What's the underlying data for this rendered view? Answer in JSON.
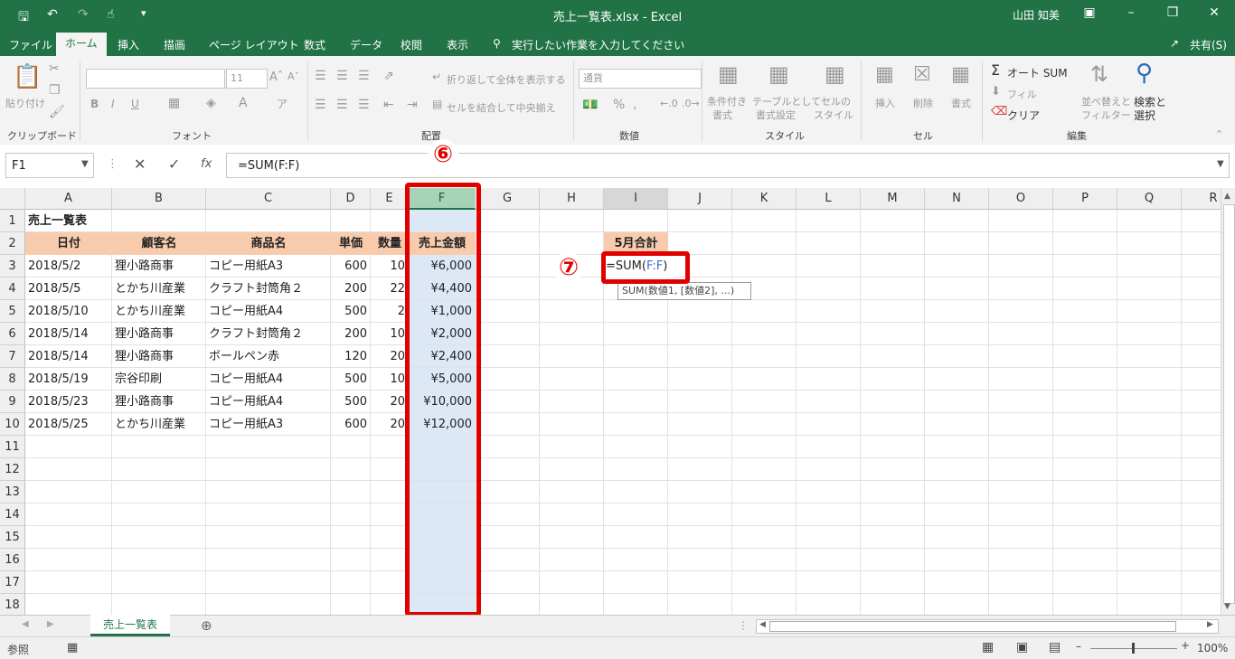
{
  "window": {
    "title": "売上一覧表.xlsx  -  Excel",
    "user": "山田 知美"
  },
  "tabs": [
    "ファイル",
    "ホーム",
    "挿入",
    "描画",
    "ページ レイアウト",
    "数式",
    "データ",
    "校閲",
    "表示"
  ],
  "active_tab": "ホーム",
  "tell_me": "実行したい作業を入力してください",
  "share": "共有(S)",
  "ribbon": {
    "clipboard": {
      "label": "クリップボード",
      "paste": "貼り付け"
    },
    "font": {
      "label": "フォント",
      "size": "11",
      "bold": "B",
      "italic": "I",
      "underline": "U"
    },
    "alignment": {
      "label": "配置",
      "wrap": "折り返して全体を表示する",
      "merge": "セルを結合して中央揃え"
    },
    "number": {
      "label": "数値",
      "format": "通貨"
    },
    "styles": {
      "label": "スタイル",
      "cond1": "条件付き",
      "cond2": "書式",
      "table1": "テーブルとして",
      "table2": "書式設定",
      "cell1": "セルの",
      "cell2": "スタイル"
    },
    "cells": {
      "label": "セル",
      "insert": "挿入",
      "delete": "削除",
      "format": "書式"
    },
    "editing": {
      "label": "編集",
      "autosum": "オート SUM",
      "fill": "フィル",
      "clear": "クリア",
      "sort1": "並べ替えと",
      "sort2": "フィルター",
      "find1": "検索と",
      "find2": "選択"
    }
  },
  "formula_bar": {
    "name_box": "F1",
    "formula": "=SUM(F:F)"
  },
  "columns": [
    "A",
    "B",
    "C",
    "D",
    "E",
    "F",
    "G",
    "H",
    "I",
    "J",
    "K",
    "L",
    "M",
    "N",
    "O",
    "P",
    "Q",
    "R"
  ],
  "rows": [
    "1",
    "2",
    "3",
    "4",
    "5",
    "6",
    "7",
    "8",
    "9",
    "10",
    "11",
    "12",
    "13",
    "14",
    "15",
    "16",
    "17",
    "18"
  ],
  "sheet": {
    "title": "売上一覧表",
    "headers": [
      "日付",
      "顧客名",
      "商品名",
      "単価",
      "数量",
      "売上金額"
    ],
    "data": [
      [
        "2018/5/2",
        "狸小路商事",
        "コピー用紙A3",
        "600",
        "10",
        "¥6,000"
      ],
      [
        "2018/5/5",
        "とかち川産業",
        "クラフト封筒角２",
        "200",
        "22",
        "¥4,400"
      ],
      [
        "2018/5/10",
        "とかち川産業",
        "コピー用紙A4",
        "500",
        "2",
        "¥1,000"
      ],
      [
        "2018/5/14",
        "狸小路商事",
        "クラフト封筒角２",
        "200",
        "10",
        "¥2,000"
      ],
      [
        "2018/5/14",
        "狸小路商事",
        "ボールペン赤",
        "120",
        "20",
        "¥2,400"
      ],
      [
        "2018/5/19",
        "宗谷印刷",
        "コピー用紙A4",
        "500",
        "10",
        "¥5,000"
      ],
      [
        "2018/5/23",
        "狸小路商事",
        "コピー用紙A4",
        "500",
        "20",
        "¥10,000"
      ],
      [
        "2018/5/25",
        "とかち川産業",
        "コピー用紙A3",
        "600",
        "20",
        "¥12,000"
      ]
    ],
    "summary_header": "5月合計",
    "editing_prefix": "=SUM(",
    "editing_ref": "F:F",
    "editing_suffix": ")",
    "tooltip": "SUM(数値1, [数値2], ...)"
  },
  "annotations": {
    "step6": "⑥",
    "step7": "⑦"
  },
  "sheet_tab": "売上一覧表",
  "status": {
    "mode": "参照",
    "zoom": "100%"
  },
  "colors": {
    "excel_green": "#217346",
    "header_fill": "#f8cbad",
    "annotation_red": "#e00000"
  }
}
